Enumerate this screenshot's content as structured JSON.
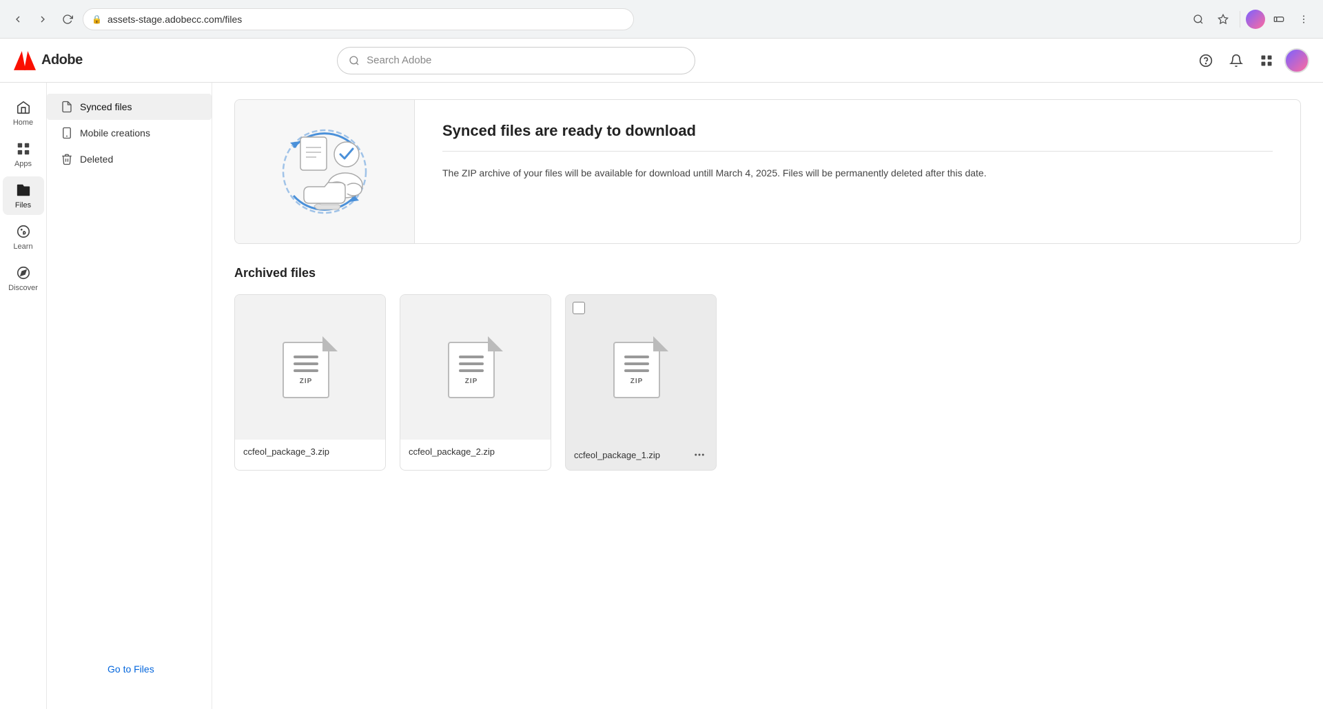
{
  "browser": {
    "url": "assets-stage.adobecc.com/files",
    "back_disabled": true,
    "forward_disabled": true
  },
  "header": {
    "logo_text": "Adobe",
    "search_placeholder": "Search Adobe"
  },
  "sidebar": {
    "items": [
      {
        "id": "home",
        "label": "Home",
        "icon": "home-icon"
      },
      {
        "id": "apps",
        "label": "Apps",
        "icon": "apps-icon"
      },
      {
        "id": "files",
        "label": "Files",
        "icon": "files-icon",
        "active": true
      },
      {
        "id": "learn",
        "label": "Learn",
        "icon": "learn-icon"
      },
      {
        "id": "discover",
        "label": "Discover",
        "icon": "discover-icon"
      }
    ]
  },
  "files_nav": {
    "items": [
      {
        "id": "synced-files",
        "label": "Synced files",
        "icon": "file-icon",
        "active": true
      },
      {
        "id": "mobile-creations",
        "label": "Mobile creations",
        "icon": "mobile-icon"
      },
      {
        "id": "deleted",
        "label": "Deleted",
        "icon": "trash-icon"
      }
    ],
    "go_to_files_label": "Go to Files"
  },
  "banner": {
    "title": "Synced files are ready to download",
    "description": "The ZIP archive of your files will be available for download untill March 4, 2025. Files will be permanently deleted after this date."
  },
  "archived_section": {
    "title": "Archived files",
    "files": [
      {
        "id": "file-3",
        "name": "ccfeol_package_3.zip",
        "type": "ZIP",
        "has_more": false
      },
      {
        "id": "file-2",
        "name": "ccfeol_package_2.zip",
        "type": "ZIP",
        "has_more": false
      },
      {
        "id": "file-1",
        "name": "ccfeol_package_1.zip",
        "type": "ZIP",
        "has_more": true
      }
    ]
  }
}
